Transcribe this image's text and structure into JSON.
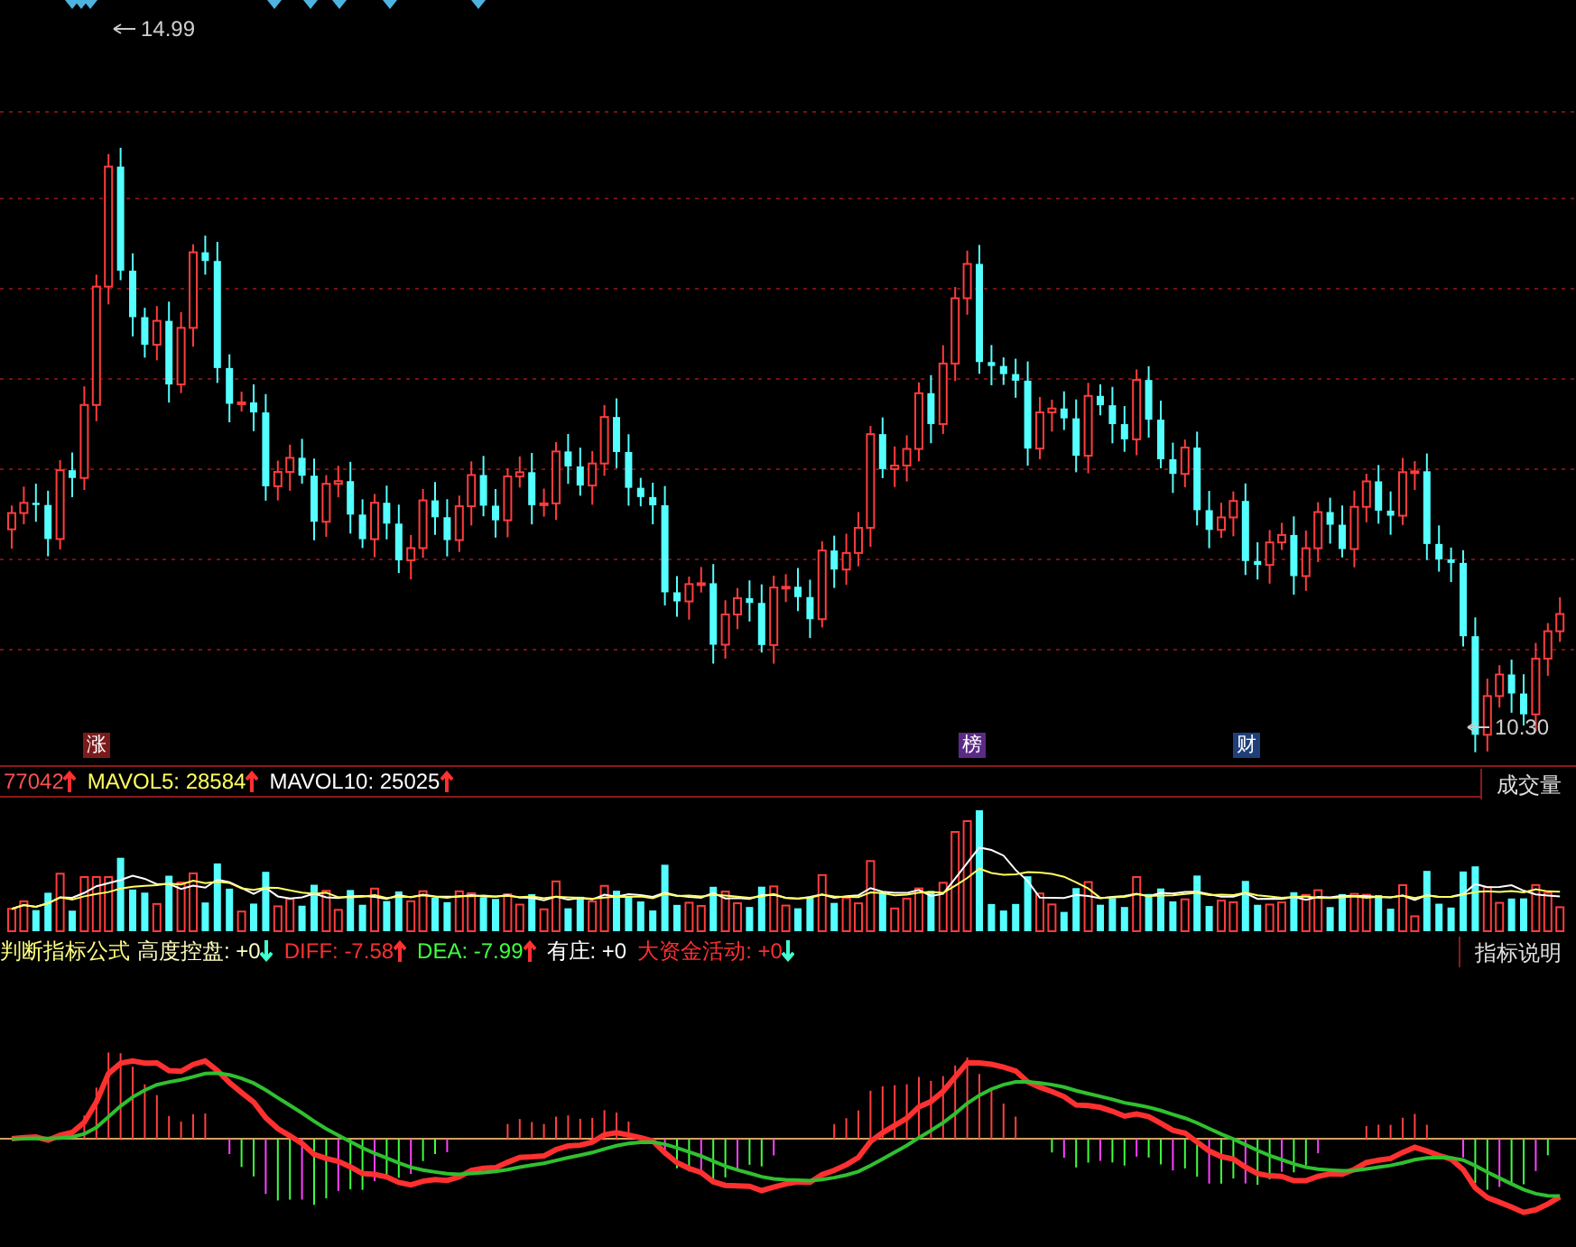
{
  "price_chart": {
    "high_label": "14.99",
    "low_label": "10.30"
  },
  "event_markers": [
    {
      "label": "涨",
      "color": "#7a1b1b"
    },
    {
      "label": "榜",
      "color": "#5b2a86"
    },
    {
      "label": "财",
      "color": "#1f3f7a"
    }
  ],
  "volume_header": {
    "items": [
      {
        "value": "77042",
        "arrow": {
          "rising": true,
          "color": "#ff3030"
        },
        "color": "#ff5050"
      },
      {
        "label": "MAVOL5:",
        "value": "28584",
        "arrow": {
          "rising": true,
          "color": "#ff3030"
        },
        "color": "#ffff60"
      },
      {
        "label": "MAVOL10:",
        "value": "25025",
        "arrow": {
          "rising": true,
          "color": "#ff3030"
        },
        "color": "#ffffff"
      }
    ],
    "button": "成交量"
  },
  "indicator_header": {
    "title": "判断指标公式",
    "items": [
      {
        "label": "高度控盘:",
        "value": "+0",
        "arrow": {
          "rising": false,
          "color": "#40ffd0"
        },
        "color": "#ffffc0"
      },
      {
        "label": "DIFF:",
        "value": "-7.58",
        "arrow": {
          "rising": true,
          "color": "#ff3030"
        },
        "color": "#ff3030"
      },
      {
        "label": "DEA:",
        "value": "-7.99",
        "arrow": {
          "rising": true,
          "color": "#ff3030"
        },
        "color": "#40ff40"
      },
      {
        "label": "有庄:",
        "value": "+0",
        "color": "#ffffff"
      },
      {
        "label": "大资金活动:",
        "value": "+0",
        "arrow": {
          "rising": false,
          "color": "#40ffd0"
        },
        "color": "#ff3030"
      }
    ],
    "button": "指标说明"
  }
}
